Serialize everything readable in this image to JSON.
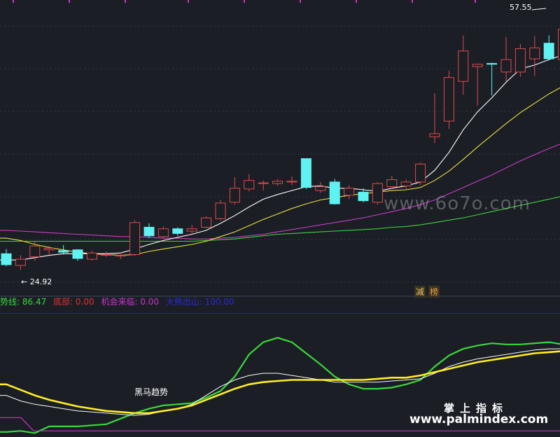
{
  "colors": {
    "background": "#1b1e25",
    "up": "#e04a4a",
    "down": "#5ff2f2",
    "ma_white": "#ffffff",
    "ma_yellow": "#e8e040",
    "ma_magenta": "#c83cc8",
    "ma_green": "#3cd23c",
    "ind_green": "#3ad83a",
    "ind_yellow": "#ffee22",
    "ind_white": "#ffffff",
    "ind_magenta": "#cc33cc",
    "ind_blue": "#2222cc",
    "grid": "#2a3a4a"
  },
  "price_labels": {
    "high": "57.55",
    "low": "24.92"
  },
  "tags": {
    "tag1": "减",
    "tag2": "榜"
  },
  "legend": {
    "trend_line": "势线: 86.47",
    "bottom": "底部: 0.00",
    "opportunity": "机会来临: 0.00",
    "hidden_label": "大熊出山: 100.00"
  },
  "annotations": {
    "dark_horse": "黑马趋势"
  },
  "watermarks": {
    "site1": "www.6o7o.com",
    "brand_cn": "掌上指标",
    "site2": "www.palmindex.com"
  },
  "chart_data": [
    {
      "type": "candlestick",
      "title": "",
      "ylim": [
        22,
        59
      ],
      "y_log": false,
      "grid": true,
      "candles": [
        {
          "o": 27.0,
          "h": 27.6,
          "l": 25.4,
          "c": 25.6
        },
        {
          "o": 25.5,
          "h": 26.8,
          "l": 24.92,
          "c": 26.3
        },
        {
          "o": 26.6,
          "h": 28.6,
          "l": 26.1,
          "c": 28.0
        },
        {
          "o": 27.5,
          "h": 28.0,
          "l": 26.9,
          "c": 27.7
        },
        {
          "o": 27.4,
          "h": 28.1,
          "l": 26.9,
          "c": 27.2
        },
        {
          "o": 27.5,
          "h": 27.6,
          "l": 26.1,
          "c": 26.4
        },
        {
          "o": 26.3,
          "h": 27.4,
          "l": 26.1,
          "c": 27.1
        },
        {
          "o": 26.8,
          "h": 27.3,
          "l": 26.6,
          "c": 26.9
        },
        {
          "o": 26.8,
          "h": 27.2,
          "l": 26.3,
          "c": 26.8
        },
        {
          "o": 26.9,
          "h": 31.3,
          "l": 26.7,
          "c": 31.0
        },
        {
          "o": 30.4,
          "h": 30.9,
          "l": 29.0,
          "c": 29.3
        },
        {
          "o": 29.2,
          "h": 30.5,
          "l": 28.9,
          "c": 30.2
        },
        {
          "o": 30.2,
          "h": 30.4,
          "l": 29.3,
          "c": 29.6
        },
        {
          "o": 29.9,
          "h": 30.7,
          "l": 29.5,
          "c": 30.2
        },
        {
          "o": 30.4,
          "h": 31.8,
          "l": 30.3,
          "c": 31.6
        },
        {
          "o": 31.5,
          "h": 33.9,
          "l": 31.3,
          "c": 33.5
        },
        {
          "o": 33.6,
          "h": 36.8,
          "l": 33.3,
          "c": 35.4
        },
        {
          "o": 35.3,
          "h": 37.2,
          "l": 35.0,
          "c": 36.4
        },
        {
          "o": 36.0,
          "h": 36.4,
          "l": 35.1,
          "c": 36.1
        },
        {
          "o": 36.0,
          "h": 36.6,
          "l": 35.7,
          "c": 36.3
        },
        {
          "o": 36.2,
          "h": 36.9,
          "l": 35.8,
          "c": 36.3
        },
        {
          "o": 39.2,
          "h": 39.2,
          "l": 35.3,
          "c": 35.5
        },
        {
          "o": 35.1,
          "h": 36.2,
          "l": 34.8,
          "c": 35.6
        },
        {
          "o": 36.2,
          "h": 36.6,
          "l": 33.3,
          "c": 33.4
        },
        {
          "o": 34.5,
          "h": 35.8,
          "l": 34.0,
          "c": 35.4
        },
        {
          "o": 34.9,
          "h": 35.4,
          "l": 33.6,
          "c": 33.8
        },
        {
          "o": 33.6,
          "h": 36.2,
          "l": 33.3,
          "c": 36.0
        },
        {
          "o": 35.6,
          "h": 37.0,
          "l": 35.3,
          "c": 36.5
        },
        {
          "o": 35.7,
          "h": 36.5,
          "l": 35.3,
          "c": 36.2
        },
        {
          "o": 36.2,
          "h": 38.7,
          "l": 35.8,
          "c": 38.5
        },
        {
          "o": 42.0,
          "h": 47.6,
          "l": 41.2,
          "c": 42.4
        },
        {
          "o": 44.0,
          "h": 50.5,
          "l": 43.0,
          "c": 49.6
        },
        {
          "o": 49.1,
          "h": 55.0,
          "l": 47.4,
          "c": 53.0
        },
        {
          "o": 51.0,
          "h": 51.4,
          "l": 46.0,
          "c": 51.3
        },
        {
          "o": 51.4,
          "h": 51.5,
          "l": 47.3,
          "c": 51.3
        },
        {
          "o": 50.3,
          "h": 54.8,
          "l": 49.1,
          "c": 51.9
        },
        {
          "o": 50.3,
          "h": 53.9,
          "l": 49.7,
          "c": 53.3
        },
        {
          "o": 52.0,
          "h": 54.9,
          "l": 49.8,
          "c": 53.4
        },
        {
          "o": 54.0,
          "h": 55.0,
          "l": 51.8,
          "c": 52.0
        },
        {
          "o": 51.9,
          "h": 57.55,
          "l": 51.4,
          "c": 55.8
        }
      ],
      "ma_white": [
        26.2,
        26.2,
        26.5,
        26.8,
        27.0,
        27.0,
        27.0,
        27.0,
        27.1,
        27.6,
        28.2,
        28.7,
        29.1,
        29.5,
        30.0,
        30.9,
        31.9,
        33.0,
        34.0,
        34.6,
        35.1,
        35.6,
        35.7,
        35.4,
        35.4,
        35.2,
        35.0,
        35.4,
        35.7,
        36.2,
        37.7,
        40.0,
        42.9,
        45.2,
        47.0,
        49.0,
        50.7,
        51.2,
        51.9,
        52.5
      ],
      "ma_yellow": [
        29.0,
        28.7,
        28.2,
        27.8,
        27.5,
        27.2,
        27.0,
        26.9,
        26.8,
        26.9,
        27.3,
        27.6,
        27.9,
        28.2,
        28.6,
        29.2,
        29.8,
        30.6,
        31.4,
        32.1,
        32.8,
        33.4,
        33.9,
        34.2,
        34.5,
        34.7,
        34.9,
        35.1,
        35.2,
        35.5,
        36.4,
        37.6,
        39.1,
        40.7,
        42.2,
        43.7,
        45.1,
        46.3,
        47.5,
        48.5
      ],
      "ma_magenta": [
        30.0,
        29.9,
        29.8,
        29.7,
        29.6,
        29.5,
        29.4,
        29.3,
        29.2,
        29.2,
        29.1,
        29.0,
        29.0,
        28.9,
        28.9,
        29.0,
        29.1,
        29.3,
        29.5,
        29.8,
        30.1,
        30.4,
        30.7,
        31.0,
        31.3,
        31.6,
        32.0,
        32.4,
        32.8,
        33.3,
        33.9,
        34.7,
        35.5,
        36.3,
        37.1,
        38.0,
        38.9,
        39.7,
        40.5,
        41.2
      ],
      "ma_green": [
        28.6,
        28.6,
        28.6,
        28.6,
        28.6,
        28.6,
        28.6,
        28.6,
        28.6,
        28.6,
        28.6,
        28.6,
        28.6,
        28.6,
        28.7,
        28.8,
        28.9,
        29.1,
        29.3,
        29.5,
        29.6,
        29.7,
        29.8,
        29.9,
        30.0,
        30.1,
        30.2,
        30.4,
        30.5,
        30.7,
        31.0,
        31.3,
        31.6,
        32.0,
        32.4,
        32.8,
        33.2,
        33.6,
        34.0,
        34.4
      ]
    },
    {
      "type": "line",
      "title": "",
      "ylim": [
        -5,
        110
      ],
      "series": [
        {
          "name": "势线",
          "values": [
            -3,
            -2,
            -4,
            2,
            2,
            2,
            3,
            4,
            9,
            14,
            18,
            21,
            22,
            23,
            28,
            34,
            47,
            67,
            78,
            82,
            78,
            68,
            58,
            47,
            40,
            36,
            36,
            37,
            40,
            44,
            56,
            66,
            72,
            75,
            77,
            76,
            76,
            77,
            78,
            76
          ]
        },
        {
          "name": "底部",
          "values": [
            10,
            10,
            -2,
            -2,
            -2,
            -2,
            -2,
            -2,
            -2,
            -2,
            -2,
            -2,
            -2,
            -2,
            -2,
            -2,
            -2,
            -2,
            -2,
            -2,
            -2,
            -2,
            -2,
            -2,
            -2,
            -2,
            -2,
            -2,
            -2,
            -2,
            -2,
            -2,
            -2,
            -2,
            -2,
            -2,
            -2,
            -2,
            -2,
            -2
          ]
        },
        {
          "series_ref": "white",
          "values": [
            30,
            25,
            22,
            20,
            18,
            16,
            15,
            14,
            13,
            12,
            13,
            16,
            18,
            22,
            30,
            38,
            44,
            48,
            50,
            50,
            48,
            46,
            44,
            42,
            42,
            42,
            42,
            43,
            44,
            45,
            50,
            56,
            60,
            63,
            65,
            67,
            69,
            71,
            72,
            72
          ]
        },
        {
          "series_ref": "yellow",
          "values": [
            40,
            35,
            30,
            26,
            23,
            20,
            18,
            16,
            15,
            14,
            14,
            16,
            18,
            21,
            26,
            31,
            36,
            40,
            42,
            43,
            44,
            44,
            44,
            44,
            44,
            44,
            45,
            46,
            46,
            48,
            51,
            54,
            57,
            60,
            62,
            64,
            66,
            68,
            69,
            70
          ]
        },
        {
          "series_ref": "blue",
          "values": [
            104,
            104,
            104,
            104,
            104,
            104,
            104,
            104,
            104,
            104,
            104,
            104,
            104,
            104,
            104,
            104,
            104,
            104,
            104,
            104,
            104,
            104,
            104,
            104,
            104,
            104,
            104,
            104,
            104,
            104,
            104,
            104,
            104,
            104,
            104,
            104,
            104,
            104,
            104,
            104
          ]
        }
      ]
    }
  ]
}
